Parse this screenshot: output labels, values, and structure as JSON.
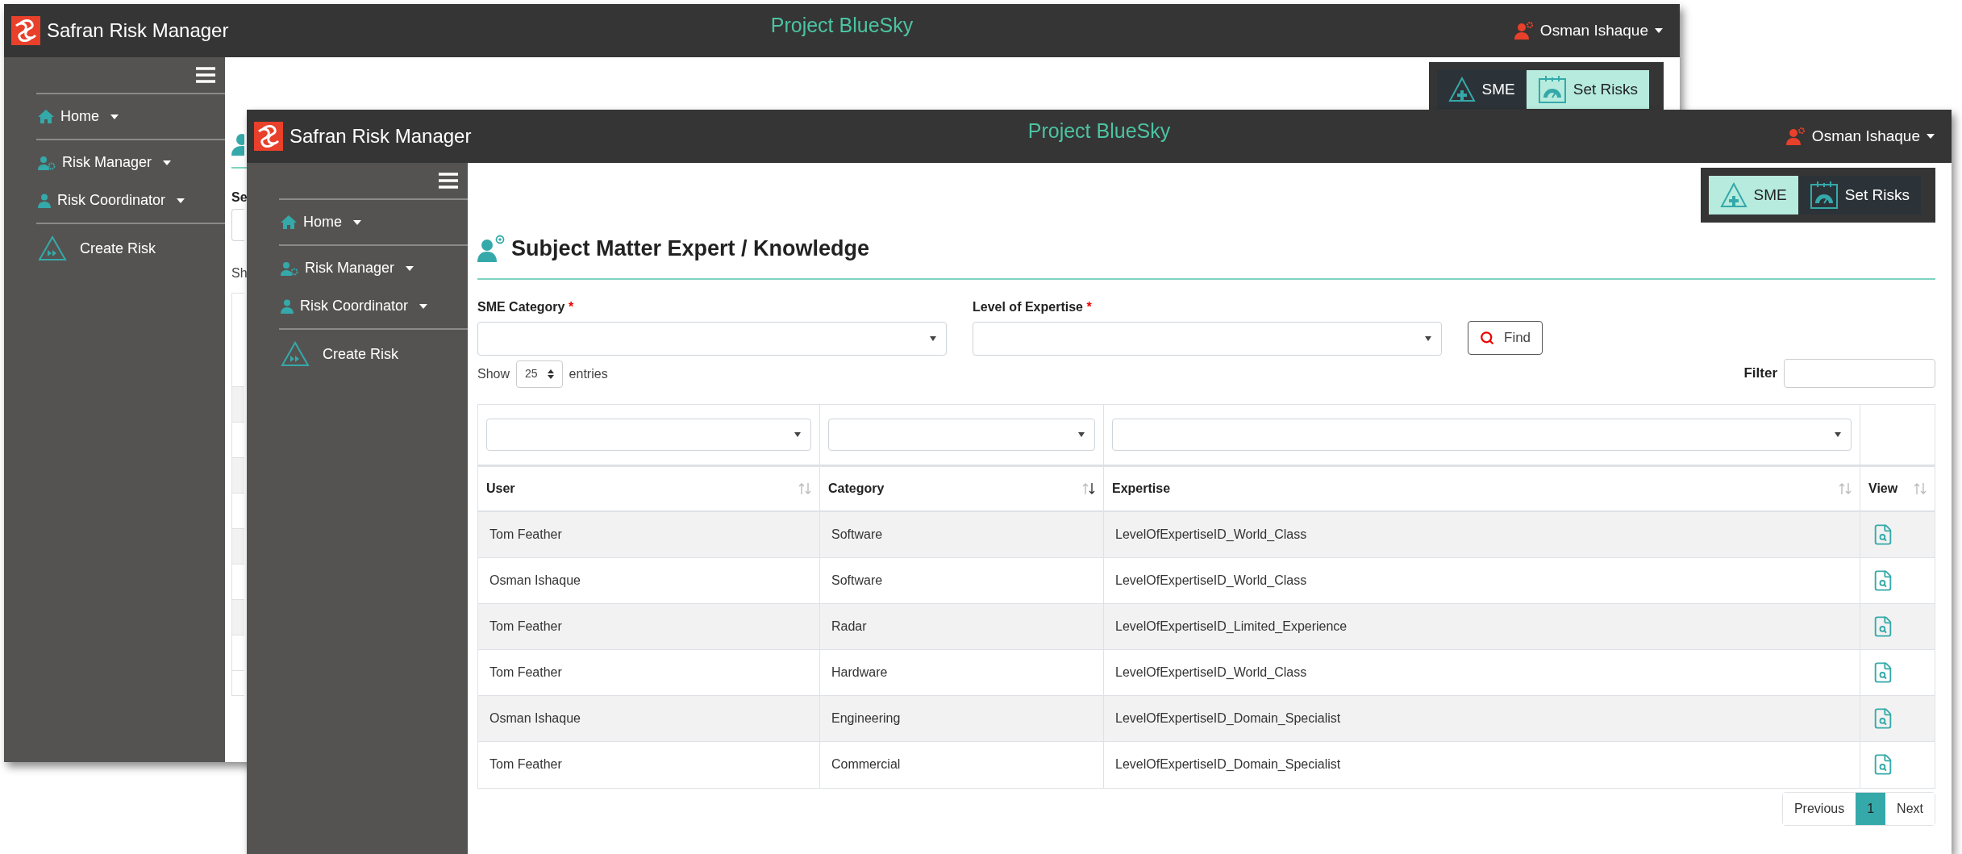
{
  "windows": [
    {
      "app_title": "Safran Risk Manager",
      "project": "Project BlueSky",
      "user": "Osman Ishaque",
      "sidebar": [
        [
          {
            "label": "Home",
            "kind": "home",
            "dropdown": true
          }
        ],
        [
          {
            "label": "Risk Manager",
            "kind": "manager",
            "dropdown": true
          },
          {
            "label": "Risk Coordinator",
            "kind": "coordinator",
            "dropdown": true
          }
        ],
        [
          {
            "label": "Create Risk",
            "kind": "create",
            "dropdown": false
          }
        ]
      ],
      "toolbar": [
        {
          "label": "SME",
          "kind": "sme",
          "selected": false
        },
        {
          "label": "Set Risks",
          "kind": "risks",
          "selected": true
        }
      ],
      "fragments": {
        "label": "Se",
        "text": "Sh"
      }
    },
    {
      "app_title": "Safran Risk Manager",
      "project": "Project BlueSky",
      "user": "Osman Ishaque",
      "sidebar": [
        [
          {
            "label": "Home",
            "kind": "home",
            "dropdown": true
          }
        ],
        [
          {
            "label": "Risk Manager",
            "kind": "manager",
            "dropdown": true
          },
          {
            "label": "Risk Coordinator",
            "kind": "coordinator",
            "dropdown": true
          }
        ],
        [
          {
            "label": "Create Risk",
            "kind": "create",
            "dropdown": false
          }
        ]
      ],
      "toolbar": [
        {
          "label": "SME",
          "kind": "sme",
          "selected": true
        },
        {
          "label": "Set Risks",
          "kind": "risks",
          "selected": false
        }
      ],
      "page": {
        "title": "Subject Matter Expert / Knowledge",
        "fields": [
          {
            "label": "SME Category",
            "required_mark": "*"
          },
          {
            "label": "Level of Expertise",
            "required_mark": "*"
          }
        ],
        "find": "Find",
        "show": {
          "before": "Show",
          "value": "25",
          "after": "entries"
        },
        "filter": {
          "label": "Filter"
        },
        "table": {
          "columns": [
            {
              "label": "User",
              "filter": true,
              "sorted": false
            },
            {
              "label": "Category",
              "filter": true,
              "sorted": true
            },
            {
              "label": "Expertise",
              "filter": true,
              "sorted": false
            },
            {
              "label": "View",
              "filter": false,
              "sorted": false
            }
          ],
          "rows": [
            [
              "Tom Feather",
              "Software",
              "LevelOfExpertiseID_World_Class"
            ],
            [
              "Osman Ishaque",
              "Software",
              "LevelOfExpertiseID_World_Class"
            ],
            [
              "Tom Feather",
              "Radar",
              "LevelOfExpertiseID_Limited_Experience"
            ],
            [
              "Tom Feather",
              "Hardware",
              "LevelOfExpertiseID_World_Class"
            ],
            [
              "Osman Ishaque",
              "Engineering",
              "LevelOfExpertiseID_Domain_Specialist"
            ],
            [
              "Tom Feather",
              "Commercial",
              "LevelOfExpertiseID_Domain_Specialist"
            ]
          ]
        },
        "pagination": [
          {
            "label": "Previous",
            "selected": false
          },
          {
            "label": "1",
            "selected": true
          },
          {
            "label": "Next",
            "selected": false
          }
        ]
      }
    }
  ]
}
